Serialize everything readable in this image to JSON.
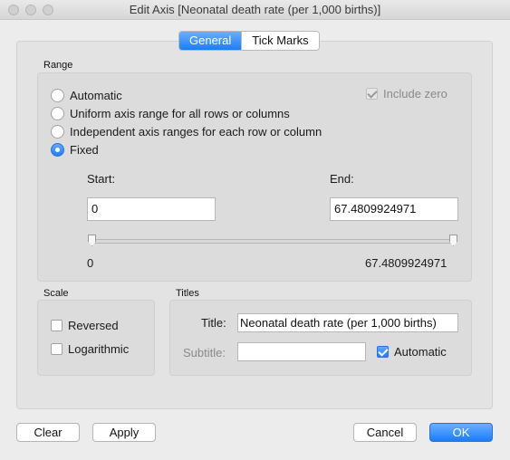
{
  "window": {
    "title": "Edit Axis [Neonatal death rate (per 1,000 births)]"
  },
  "tabs": [
    {
      "label": "General",
      "active": true
    },
    {
      "label": "Tick Marks",
      "active": false
    }
  ],
  "range": {
    "group_label": "Range",
    "options": [
      {
        "label": "Automatic",
        "selected": false
      },
      {
        "label": "Uniform axis range for all rows or columns",
        "selected": false
      },
      {
        "label": "Independent axis ranges for each row or column",
        "selected": false
      },
      {
        "label": "Fixed",
        "selected": true
      }
    ],
    "include_zero": {
      "label": "Include zero",
      "checked": true,
      "disabled": true
    },
    "start_label": "Start:",
    "start_value": "0",
    "end_label": "End:",
    "end_value": "67.4809924971",
    "slider_min_label": "0",
    "slider_max_label": "67.4809924971"
  },
  "scale": {
    "group_label": "Scale",
    "reversed": {
      "label": "Reversed",
      "checked": false
    },
    "logarithmic": {
      "label": "Logarithmic",
      "checked": false
    }
  },
  "titles": {
    "group_label": "Titles",
    "title_label": "Title:",
    "title_value": "Neonatal death rate (per 1,000 births)",
    "subtitle_label": "Subtitle:",
    "subtitle_value": "",
    "automatic": {
      "label": "Automatic",
      "checked": true
    }
  },
  "buttons": {
    "clear": "Clear",
    "apply": "Apply",
    "cancel": "Cancel",
    "ok": "OK"
  },
  "colors": {
    "accent": "#1c7dfa"
  }
}
